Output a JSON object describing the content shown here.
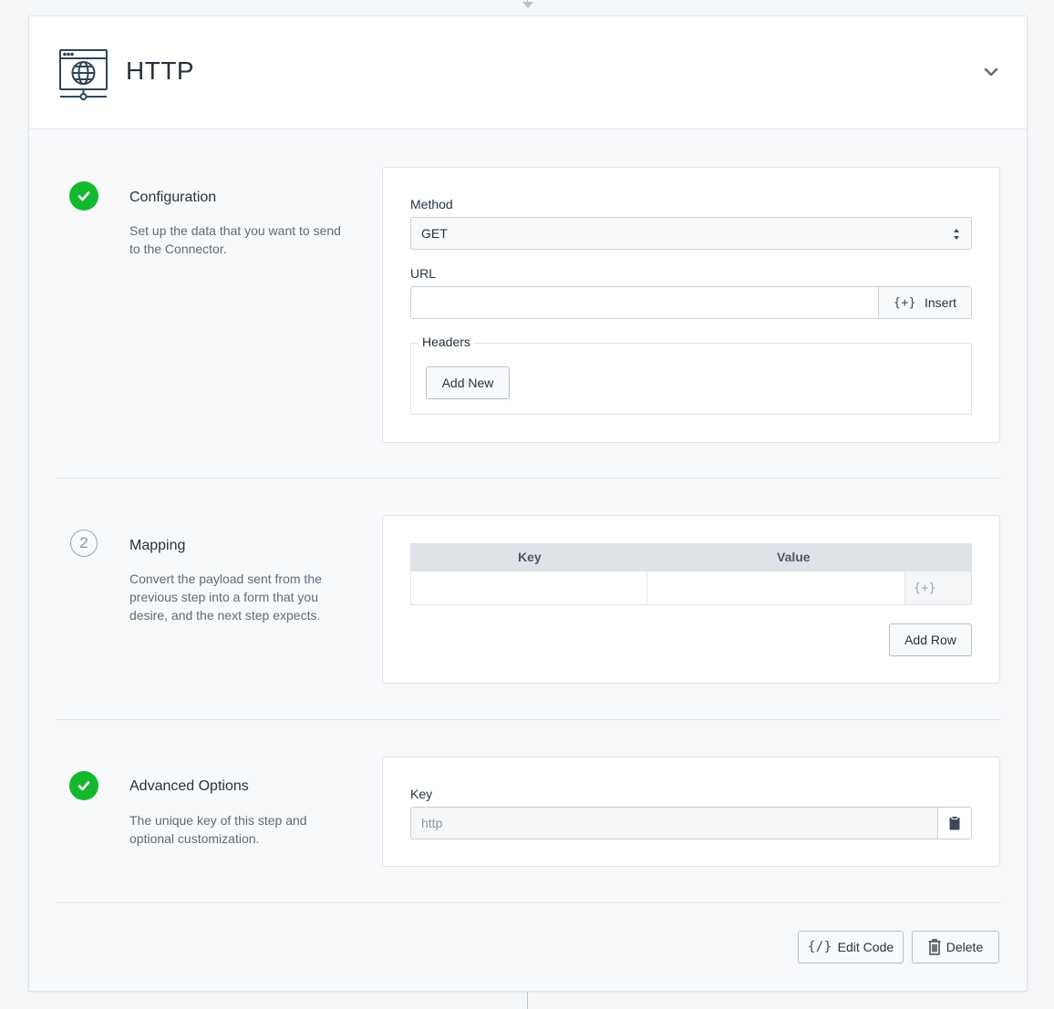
{
  "header": {
    "title": "HTTP"
  },
  "configuration": {
    "title": "Configuration",
    "description": "Set up the data that you want to send to the Connector.",
    "method_label": "Method",
    "method_value": "GET",
    "url_label": "URL",
    "url_value": "",
    "insert_label": "Insert",
    "insert_glyph": "{+}",
    "headers_label": "Headers",
    "add_new_label": "Add New"
  },
  "mapping": {
    "step_number": "2",
    "title": "Mapping",
    "description": "Convert the payload sent from the previous step into a form that you desire, and the next step expects.",
    "columns": [
      "Key",
      "Value"
    ],
    "insert_glyph": "{+}",
    "add_row_label": "Add Row"
  },
  "advanced": {
    "title": "Advanced Options",
    "description": "The unique key of this step and optional customization.",
    "key_label": "Key",
    "key_value": "http"
  },
  "footer": {
    "edit_code_glyph": "{/}",
    "edit_code_label": "Edit Code",
    "delete_label": "Delete"
  },
  "colors": {
    "success": "#14b82e",
    "border": "#dfe3e7",
    "text": "#26323d"
  },
  "icons": [
    "globe-window-icon",
    "chevron-down-icon",
    "check-icon",
    "select-arrows-icon",
    "clipboard-icon",
    "trash-icon"
  ]
}
